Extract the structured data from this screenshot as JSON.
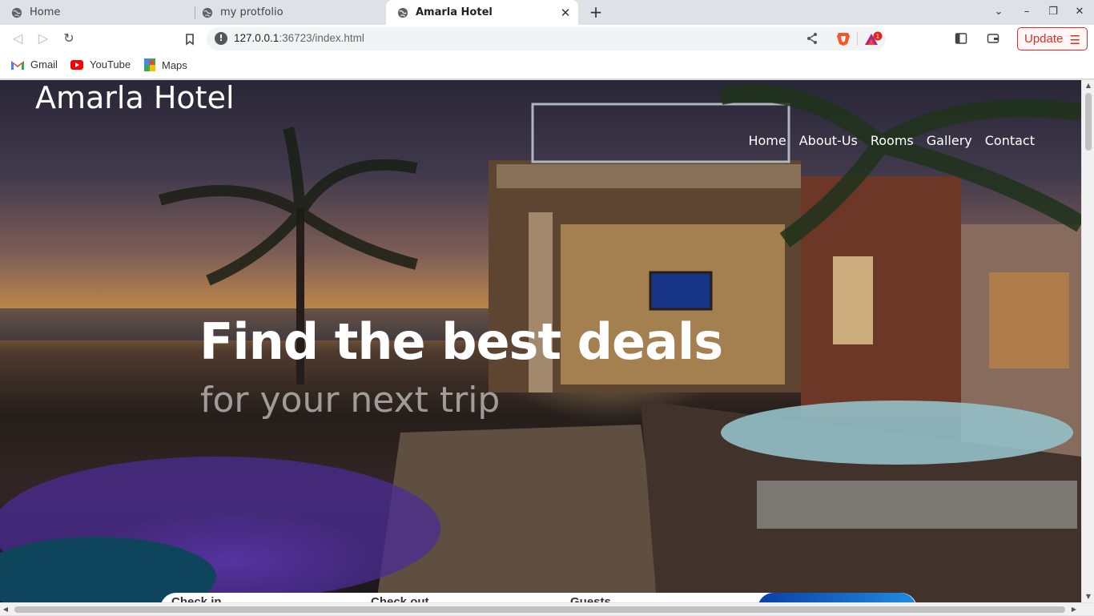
{
  "browser": {
    "tabs": [
      {
        "title": "Home"
      },
      {
        "title": "my protfolio"
      },
      {
        "title": "Amarla Hotel"
      }
    ],
    "new_tab_label": "+",
    "address": {
      "host": "127.0.0.1",
      "rest": ":36723/index.html"
    },
    "update_label": "Update",
    "rewards_badge": "1",
    "bookmarks": [
      {
        "label": "Gmail"
      },
      {
        "label": "YouTube"
      },
      {
        "label": "Maps"
      }
    ]
  },
  "site": {
    "logo": "Amarla Hotel",
    "nav": [
      "Home",
      "About-Us",
      "Rooms",
      "Gallery",
      "Contact"
    ],
    "hero_title": "Find the best deals",
    "hero_subtitle": "for your next trip",
    "booking": {
      "check_in": "Check in",
      "check_out": "Check out",
      "guests": "Guests"
    }
  },
  "colors": {
    "accent_update": "#d93025",
    "cta_start": "#0b3fa8",
    "cta_end": "#1f8ce0"
  }
}
